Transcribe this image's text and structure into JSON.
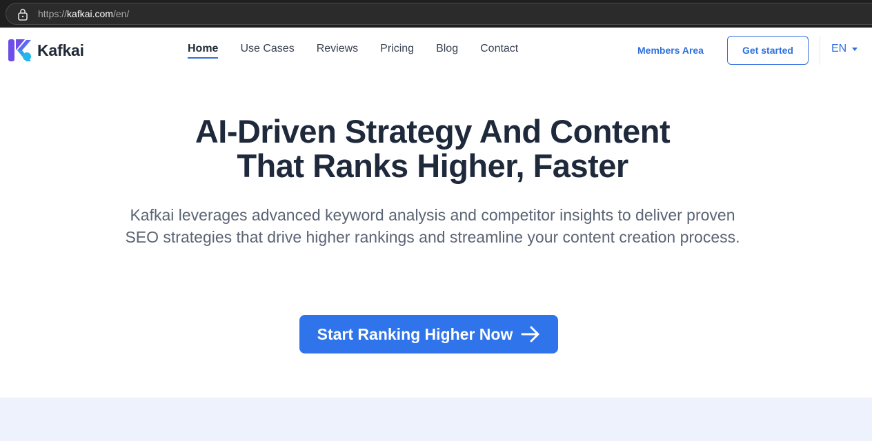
{
  "browser": {
    "url_prefix": "https://",
    "url_host": "kafkai.com",
    "url_path": "/en/"
  },
  "header": {
    "brand": "Kafkai",
    "nav": [
      "Home",
      "Use Cases",
      "Reviews",
      "Pricing",
      "Blog",
      "Contact"
    ],
    "active_nav": "Home",
    "members_label": "Members Area",
    "cta_label": "Get started",
    "language": "EN"
  },
  "hero": {
    "title_line1": "AI-Driven Strategy And Content",
    "title_line2": "That Ranks Higher, Faster",
    "subtitle": "Kafkai leverages advanced keyword analysis and competitor insights to deliver proven SEO strategies that drive higher rankings and streamline your content creation process.",
    "cta_label": "Start Ranking Higher Now"
  },
  "colors": {
    "brand_blue": "#2f6fdd",
    "cta_blue": "#2f74eb",
    "heading": "#1e293b",
    "band_bg": "#edf2fc"
  },
  "icons": {
    "lock": "lock-icon",
    "logo": "kafkai-logo-icon",
    "caret": "chevron-down-icon",
    "arrow": "arrow-right-icon"
  }
}
